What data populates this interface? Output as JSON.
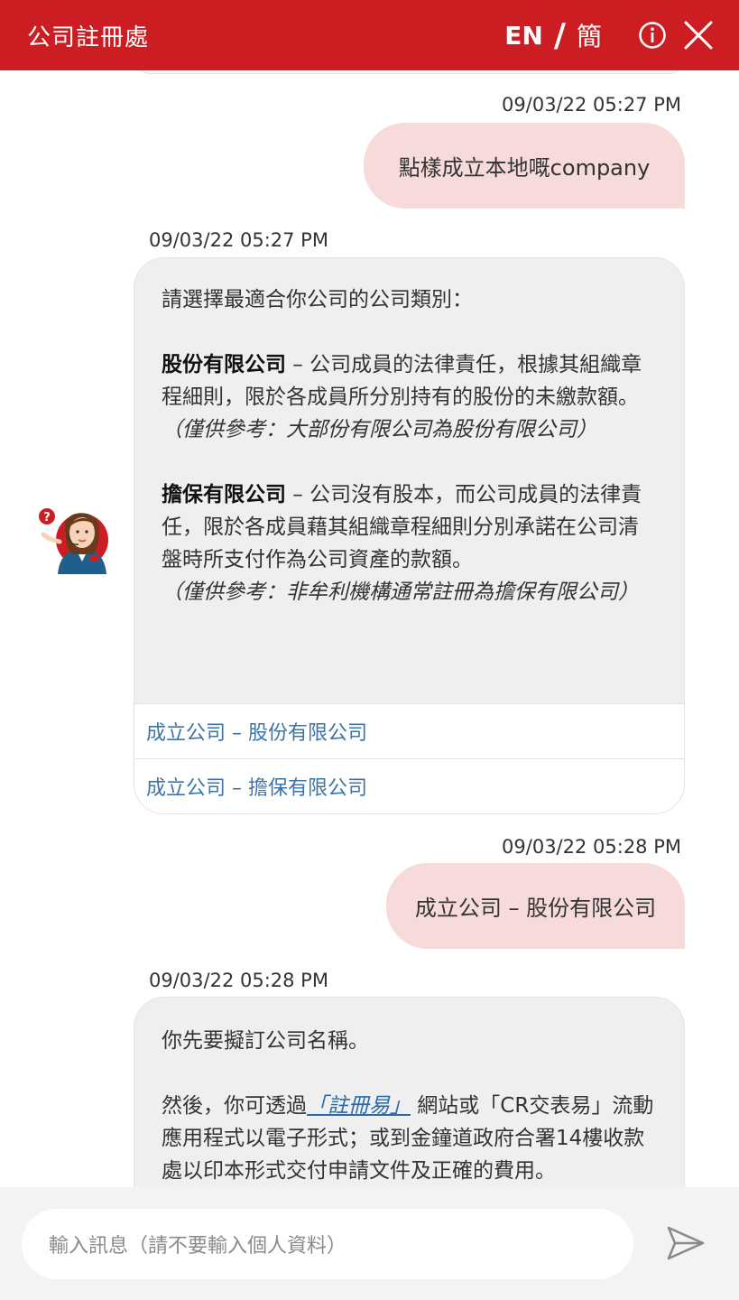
{
  "header": {
    "title": "公司註冊處",
    "lang_en": "EN",
    "lang_slash": "/",
    "lang_sc": "簡",
    "bg_color": "#cc1e22"
  },
  "messages": {
    "user1": {
      "timestamp": "09/03/22 05:27 PM",
      "text": "點樣成立本地嘅company"
    },
    "bot1": {
      "timestamp": "09/03/22 05:27 PM",
      "intro": "請選擇最適合你公司的公司類別：",
      "type1_name": "股份有限公司",
      "type1_desc": " – 公司成員的法律責任，根據其組織章程細則，限於各成員所分別持有的股份的未繳款額。",
      "type1_note": "（僅供參考：大部份有限公司為股份有限公司）",
      "type2_name": "擔保有限公司",
      "type2_desc": " – 公司沒有股本，而公司成員的法律責任，限於各成員藉其組織章程細則分別承諾在公司清盤時所支付作為公司資產的款額。",
      "type2_note": "（僅供參考：非牟利機構通常註冊為擔保有限公司）",
      "options": [
        "成立公司 – 股份有限公司",
        "成立公司 – 擔保有限公司"
      ]
    },
    "user2": {
      "timestamp": "09/03/22 05:28 PM",
      "text": "成立公司 – 股份有限公司"
    },
    "bot2": {
      "timestamp": "09/03/22 05:28 PM",
      "line1": "你先要擬訂公司名稱。",
      "line2_prefix": "然後，你可透過",
      "line2_link": "「註冊易」",
      "line2_suffix": " 網站或「CR交表易」流動應用程式以電子形式；或到金鐘道政府合署14樓收款處以印本形式交付申請文件及正確的費用。"
    }
  },
  "input": {
    "placeholder": "輸入訊息（請不要輸入個人資料）"
  },
  "icons": {
    "info": "info-circle-icon",
    "close": "close-icon",
    "send": "send-icon",
    "avatar": "agent-avatar-icon"
  }
}
